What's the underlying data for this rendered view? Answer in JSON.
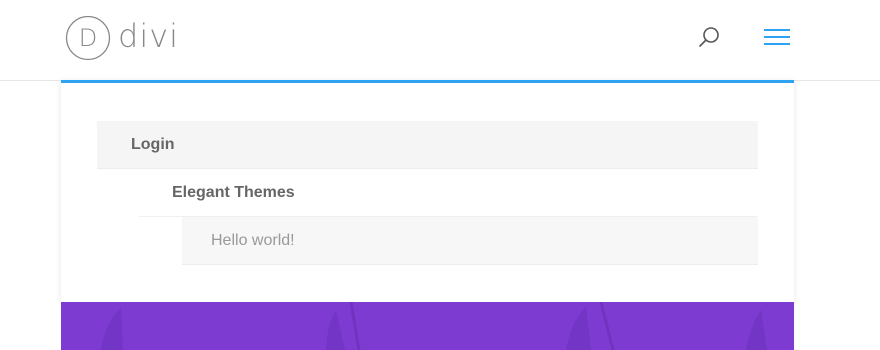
{
  "header": {
    "logo_text": "divi",
    "logo_icon": "divi-logo-icon",
    "search_icon": "search-icon",
    "menu_icon": "hamburger-menu-icon"
  },
  "menu": {
    "items": [
      {
        "label": "Login"
      },
      {
        "label": "Elegant Themes"
      },
      {
        "label": "Hello world!"
      }
    ]
  },
  "colors": {
    "accent": "#2ea3f2",
    "banner": "#7d3bd1",
    "text": "#666666",
    "muted_text": "#999999"
  }
}
